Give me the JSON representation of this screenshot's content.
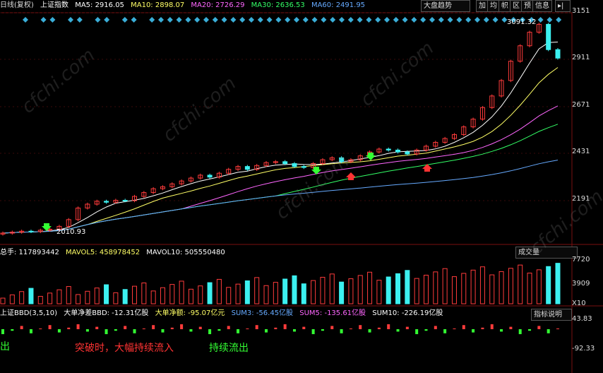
{
  "header": {
    "period": "日线(复权)",
    "index_name": "上证指数",
    "ma5": "MA5: 2916.05",
    "ma10": "MA10: 2898.07",
    "ma20": "MA20: 2726.29",
    "ma30": "MA30: 2636.53",
    "ma60": "MA60: 2491.95"
  },
  "toolbar": {
    "trend": "大盘趋势",
    "add": "加",
    "jun": "均",
    "zhi": "帜",
    "qu": "区",
    "yu": "预",
    "info": "信息"
  },
  "price_axis": [
    "3151",
    "2911",
    "2671",
    "2431",
    "2191"
  ],
  "volume_header": {
    "total": "总手: 117893442",
    "mavol5": "MAVOL5: 458978452",
    "mavol10": "MAVOL10: 505550480",
    "menu": "成交量"
  },
  "volume_axis": [
    "7720",
    "3909",
    "X10"
  ],
  "bbd_header": {
    "title": "上证BBD(3,5,10)",
    "bbd": "大单净差BBD: -12.31亿股",
    "net": "大单净额: -95.07亿元",
    "sum3": "SUM3: -56.45亿股",
    "sum5": "SUM5: -135.61亿股",
    "sum10": "SUM10: -226.19亿股",
    "menu": "指标说明"
  },
  "bbd_axis": [
    "43.83",
    "-92.33"
  ],
  "annotations": {
    "high": "3091.32",
    "low": "2010.93",
    "out_left": "出",
    "break": "突破时，大幅持续流入",
    "out": "持续流出"
  },
  "watermark": "cfchi.com",
  "colors": {
    "up": "#ff3b3b",
    "down": "#3cf0f0",
    "ma5": "#ffffff",
    "ma10": "#ffff66",
    "ma20": "#ff66ff",
    "ma30": "#33ff66",
    "ma60": "#66aaff"
  },
  "chart_data": [
    {
      "type": "candlestick",
      "title": "上证指数",
      "ylim": [
        2010,
        3151
      ],
      "series_close": [
        2010,
        2015,
        2020,
        2018,
        2025,
        2030,
        2045,
        2080,
        2140,
        2160,
        2175,
        2170,
        2180,
        2178,
        2200,
        2220,
        2240,
        2250,
        2265,
        2280,
        2295,
        2310,
        2300,
        2320,
        2340,
        2355,
        2340,
        2360,
        2375,
        2380,
        2370,
        2355,
        2350,
        2370,
        2390,
        2400,
        2380,
        2390,
        2410,
        2430,
        2445,
        2440,
        2430,
        2420,
        2440,
        2460,
        2480,
        2500,
        2520,
        2560,
        2600,
        2660,
        2720,
        2800,
        2900,
        2980,
        3050,
        3091,
        2960,
        2916
      ],
      "ma_values": {
        "MA5": 2916.05,
        "MA10": 2898.07,
        "MA20": 2726.29,
        "MA30": 2636.53,
        "MA60": 2491.95
      }
    },
    {
      "type": "bar",
      "title": "成交量",
      "ylim": [
        0,
        7720
      ]
    },
    {
      "type": "bar",
      "title": "上证BBD",
      "ylim": [
        -92.33,
        43.83
      ],
      "values": {
        "BBD": -12.31,
        "SUM3": -56.45,
        "SUM5": -135.61,
        "SUM10": -226.19
      }
    }
  ]
}
